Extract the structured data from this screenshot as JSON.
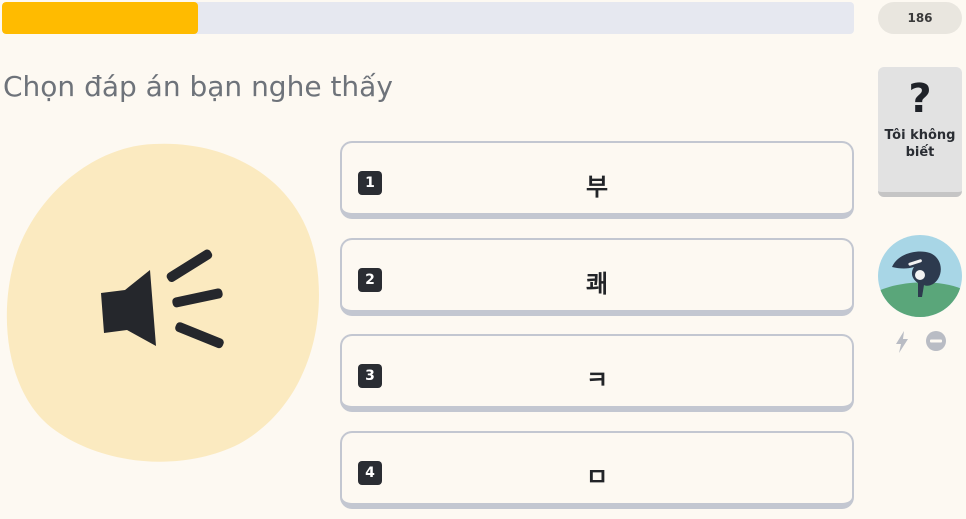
{
  "progress": {
    "fraction": 0.23
  },
  "score": {
    "value": "186"
  },
  "prompt": {
    "text": "Chọn đáp án bạn nghe thấy"
  },
  "audio": {
    "icon": "speaker-icon"
  },
  "options": [
    {
      "number": "1",
      "text": "부"
    },
    {
      "number": "2",
      "text": "쾌"
    },
    {
      "number": "3",
      "text": "ㅋ"
    },
    {
      "number": "4",
      "text": "ㅁ"
    }
  ],
  "dont_know": {
    "icon": "question-icon",
    "label": "Tôi không biết"
  },
  "avatar": {
    "icon": "avatar-icon"
  },
  "status": {
    "icons": [
      "lightning-icon",
      "minus-circle-icon"
    ]
  },
  "colors": {
    "progress_fill": "#ffbb00",
    "progress_track": "#e6e8f0",
    "blob": "#fbeac0",
    "background": "#fdf9f2"
  }
}
